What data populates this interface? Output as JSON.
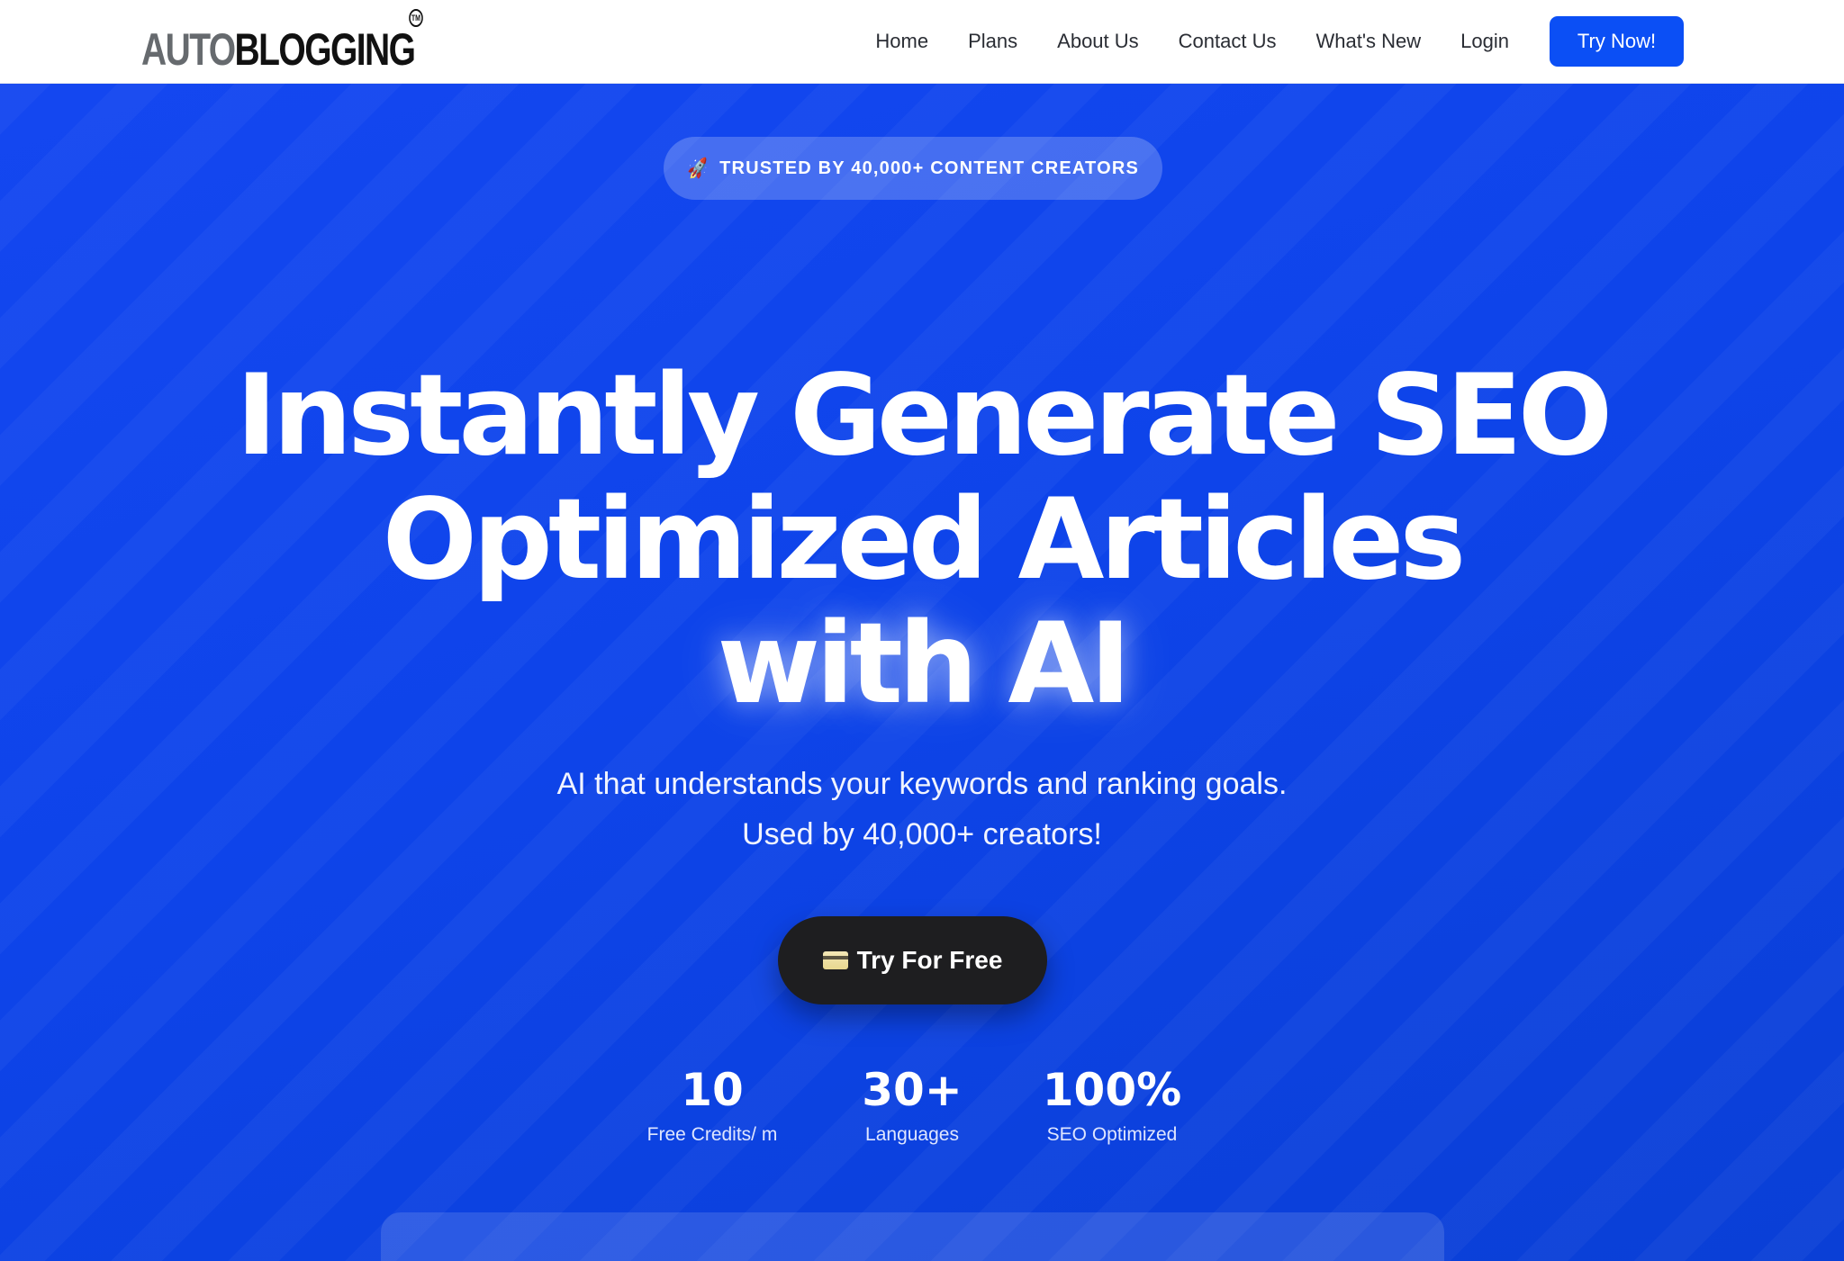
{
  "header": {
    "logo": {
      "part1": "AUTO",
      "part2": "BLOGGING",
      "mark": "TM"
    },
    "nav": [
      {
        "label": "Home"
      },
      {
        "label": "Plans"
      },
      {
        "label": "About Us"
      },
      {
        "label": "Contact Us"
      },
      {
        "label": "What's New"
      },
      {
        "label": "Login"
      }
    ],
    "cta_label": "Try Now!"
  },
  "hero": {
    "badge": {
      "icon": "rocket-icon",
      "text": "TRUSTED BY 40,000+ CONTENT CREATORS"
    },
    "headline": {
      "line1": "Instantly Generate SEO",
      "line2": "Optimized Articles",
      "line3": "with AI"
    },
    "subtext": {
      "line1": "AI that understands your keywords and ranking goals.",
      "line2": "Used by 40,000+ creators!"
    },
    "cta": {
      "icon": "credit-card-icon",
      "label": "Try For Free"
    },
    "stats": [
      {
        "value": "10",
        "label": "Free Credits/ m"
      },
      {
        "value": "30+",
        "label": "Languages"
      },
      {
        "value": "100%",
        "label": "SEO Optimized"
      }
    ]
  },
  "colors": {
    "brand_blue": "#0b4ff5",
    "hero_blue": "#1447f0",
    "cta_dark": "#1e1e20"
  }
}
